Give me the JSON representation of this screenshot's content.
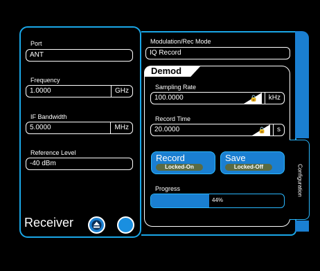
{
  "receiver": {
    "port": {
      "label": "Port",
      "value": "ANT"
    },
    "frequency": {
      "label": "Frequency",
      "value": "1.0000",
      "unit": "GHz"
    },
    "if_bandwidth": {
      "label": "IF Bandwidth",
      "value": "5.0000",
      "unit": "MHz"
    },
    "reference_level": {
      "label": "Reference Level",
      "value": "-40 dBm"
    },
    "title": "Receiver"
  },
  "mode": {
    "label": "Modulation/Rec Mode",
    "value": "IQ Record"
  },
  "demod": {
    "title": "Demod",
    "sampling_rate": {
      "label": "Sampling Rate",
      "value": "100.0000",
      "unit": "kHz"
    },
    "record_time": {
      "label": "Record Time",
      "value": "20.0000",
      "unit": "s"
    },
    "record_button": {
      "label": "Record",
      "state": "Locked-On"
    },
    "save_button": {
      "label": "Save",
      "state": "Locked-Off"
    },
    "progress": {
      "label": "Progress",
      "value": 44,
      "text": "44%"
    }
  },
  "side_tab": {
    "label": "Configuration"
  },
  "colors": {
    "accent": "#1aa7e8",
    "button": "#1a7fd1",
    "locked": "#5a6b43"
  },
  "icons": {
    "eject": "eject-icon",
    "lock": "lock-icon"
  }
}
